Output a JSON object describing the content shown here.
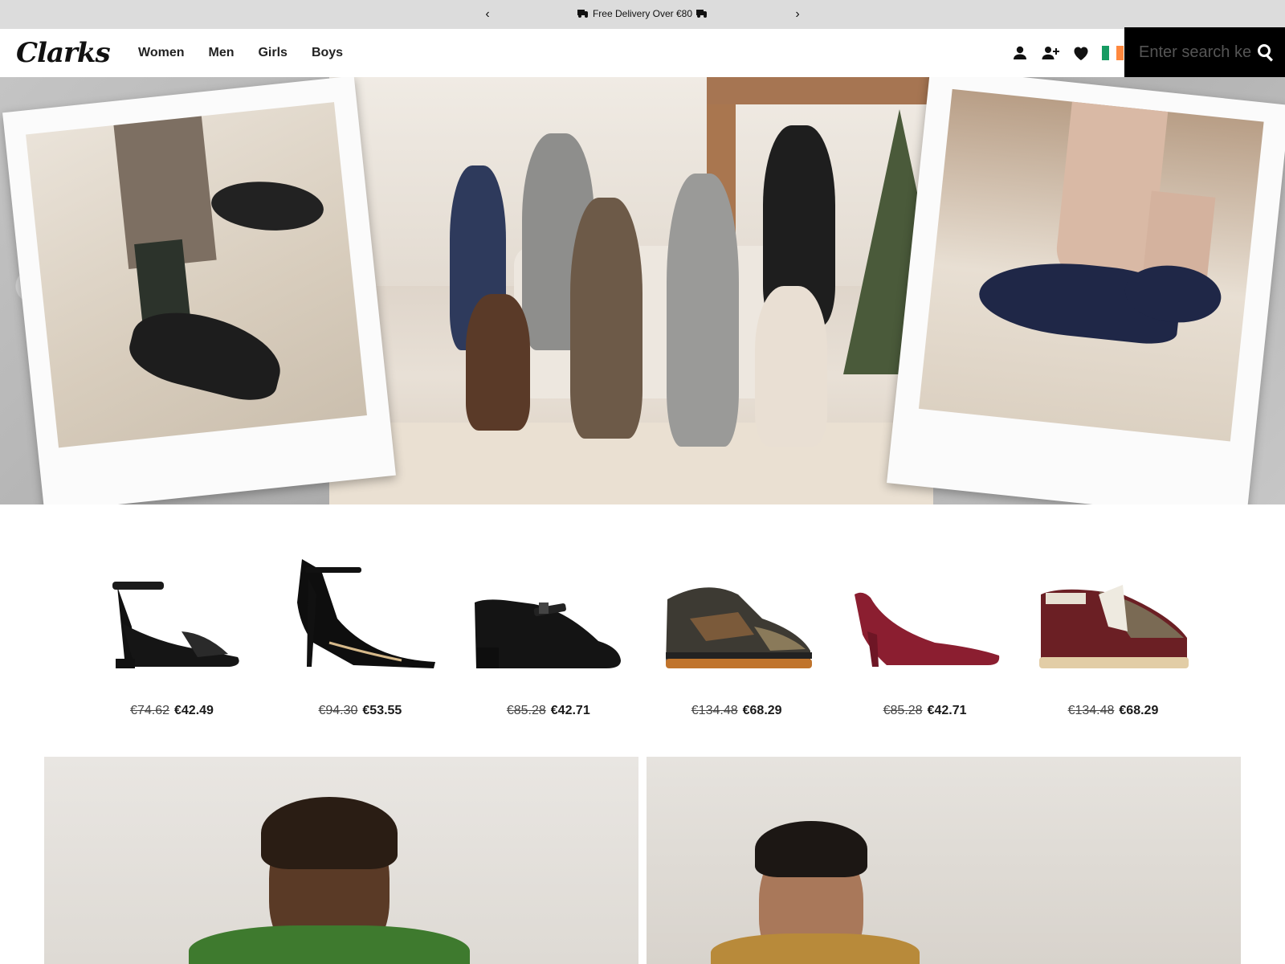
{
  "promo": {
    "message": "Free Delivery Over €80",
    "prev_label": "‹",
    "next_label": "›"
  },
  "header": {
    "logo_text": "Clarks",
    "nav": [
      "Women",
      "Men",
      "Girls",
      "Boys"
    ],
    "icons": [
      "account-icon",
      "register-icon",
      "wishlist-heart-icon",
      "ireland-flag-icon"
    ],
    "flag_colors": [
      "#169b62",
      "#ffffff",
      "#ff883e"
    ],
    "search": {
      "placeholder": "Enter search keyword"
    }
  },
  "colors": {
    "promo_bg": "#dcdcdc",
    "search_bg": "#000000"
  },
  "hero": {
    "description_icons": [
      "mens-brogue-photo",
      "family-group-photo",
      "navy-court-shoe-photo"
    ]
  },
  "products": [
    {
      "old_price": "€74.62",
      "new_price": "€42.49"
    },
    {
      "old_price": "€94.30",
      "new_price": "€53.55"
    },
    {
      "old_price": "€85.28",
      "new_price": "€42.71"
    },
    {
      "old_price": "€134.48",
      "new_price": "€68.29"
    },
    {
      "old_price": "€85.28",
      "new_price": "€42.71"
    },
    {
      "old_price": "€134.48",
      "new_price": "€68.29"
    }
  ]
}
